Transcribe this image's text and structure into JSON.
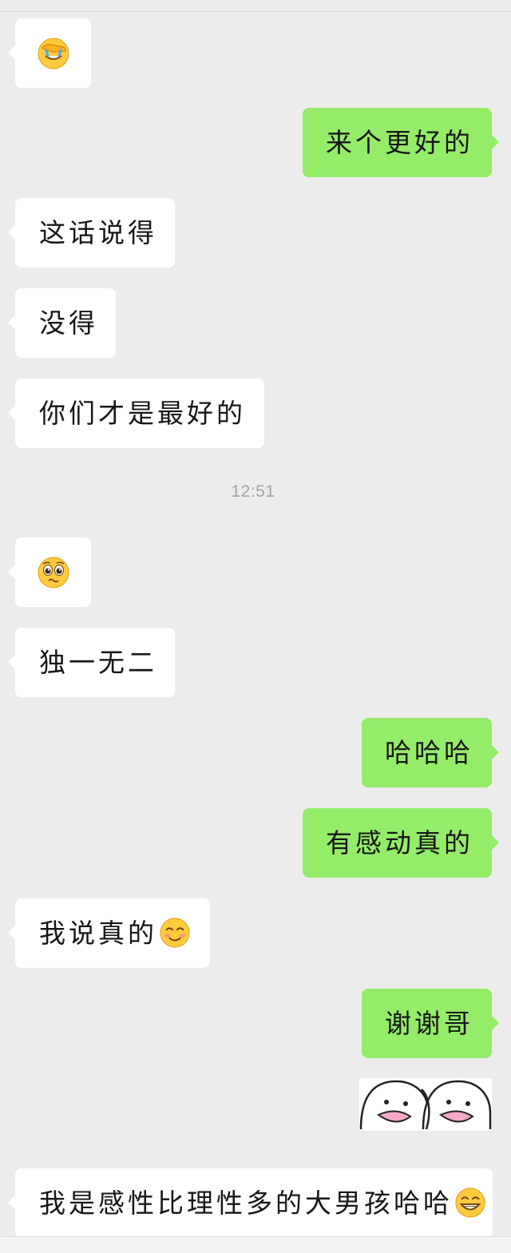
{
  "messages": [
    {
      "side": "in",
      "emoji": "facepalm-emoji"
    },
    {
      "side": "out",
      "text": "来个更好的"
    },
    {
      "side": "in",
      "text": "这话说得"
    },
    {
      "side": "in",
      "text": "没得"
    },
    {
      "side": "in",
      "text": "你们才是最好的"
    },
    {
      "side": "in",
      "emoji": "pleading-face-emoji"
    },
    {
      "side": "in",
      "text": "独一无二"
    },
    {
      "side": "out",
      "text": "哈哈哈"
    },
    {
      "side": "out",
      "text": "有感动真的"
    },
    {
      "side": "in",
      "text": "我说真的",
      "emoji": "blushing-smile-emoji"
    },
    {
      "side": "out",
      "text": "谢谢哥"
    },
    {
      "side": "out",
      "sticker": "two-ghost-faces-sticker"
    },
    {
      "side": "in",
      "text": "我是感性比理性多的大男孩哈哈",
      "emoji": "grinning-face-emoji"
    }
  ],
  "timestamp": "12:51",
  "colors": {
    "background": "#ececec",
    "incoming_bubble": "#ffffff",
    "outgoing_bubble": "#95ec69",
    "timestamp": "#a3a3a3"
  }
}
